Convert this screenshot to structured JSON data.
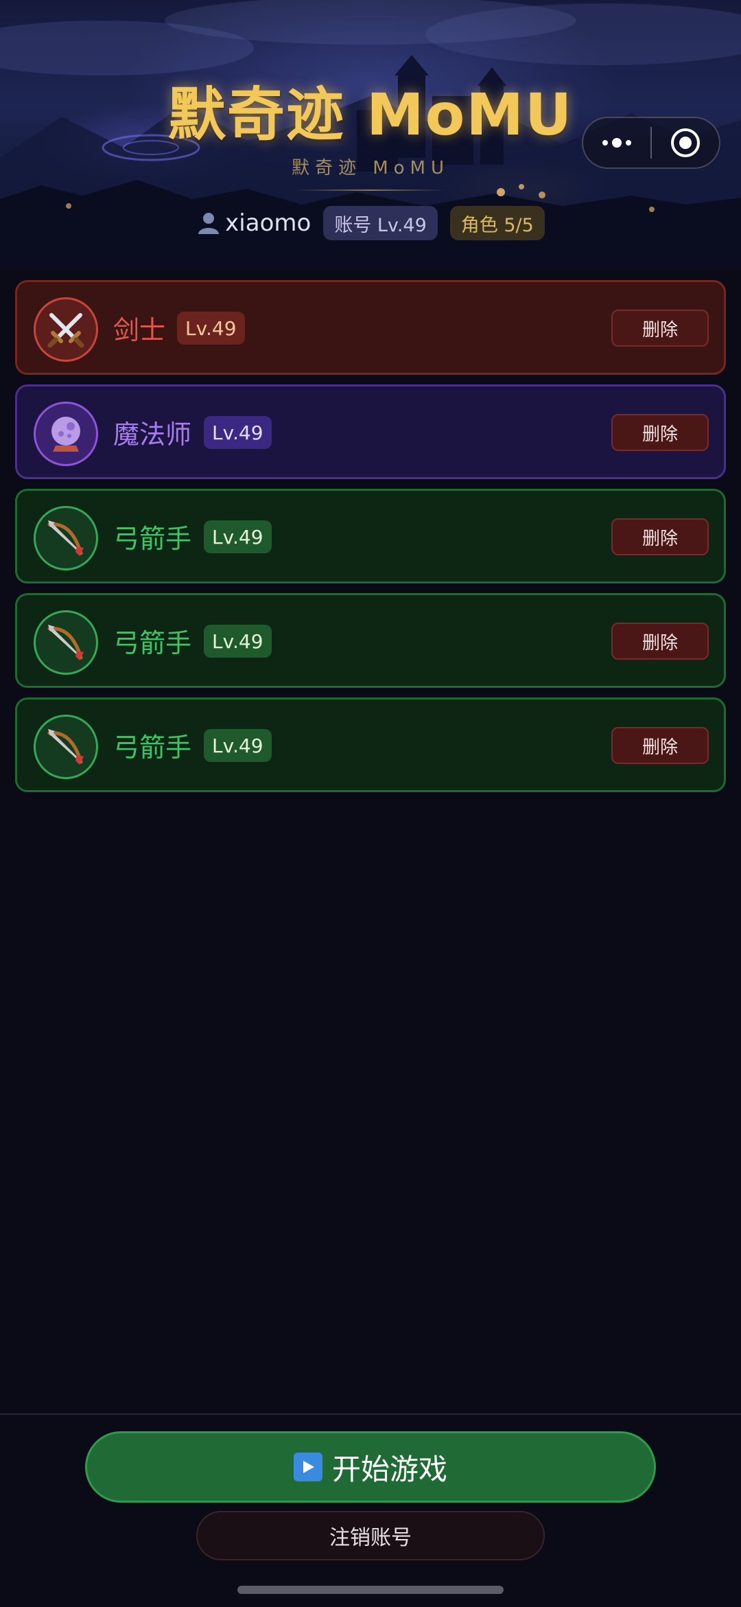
{
  "header": {
    "title": "默奇迹 MoMU",
    "subtitle": "默奇迹 MoMU",
    "username": "xiaomo",
    "account_level": "账号 Lv.49",
    "role_count": "角色 5/5"
  },
  "capsule": {
    "more_icon": "more-dots-icon",
    "close_icon": "target-close-icon"
  },
  "characters": [
    {
      "class": "剑士",
      "level": "Lv.49",
      "icon": "crossed-swords-icon",
      "color": "#e2564b",
      "delete_label": "删除"
    },
    {
      "class": "魔法师",
      "level": "Lv.49",
      "icon": "crystal-ball-icon",
      "color": "#a77cf0",
      "delete_label": "删除"
    },
    {
      "class": "弓箭手",
      "level": "Lv.49",
      "icon": "bow-and-arrow-icon",
      "color": "#42c266",
      "delete_label": "删除"
    },
    {
      "class": "弓箭手",
      "level": "Lv.49",
      "icon": "bow-and-arrow-icon",
      "color": "#42c266",
      "delete_label": "删除"
    },
    {
      "class": "弓箭手",
      "level": "Lv.49",
      "icon": "bow-and-arrow-icon",
      "color": "#42c266",
      "delete_label": "删除"
    }
  ],
  "footer": {
    "start_label": "开始游戏",
    "logout_label": "注销账号"
  },
  "colors": {
    "background": "#0a0b17",
    "title_gold": "#f3c85a",
    "start_green": "#206a35"
  }
}
